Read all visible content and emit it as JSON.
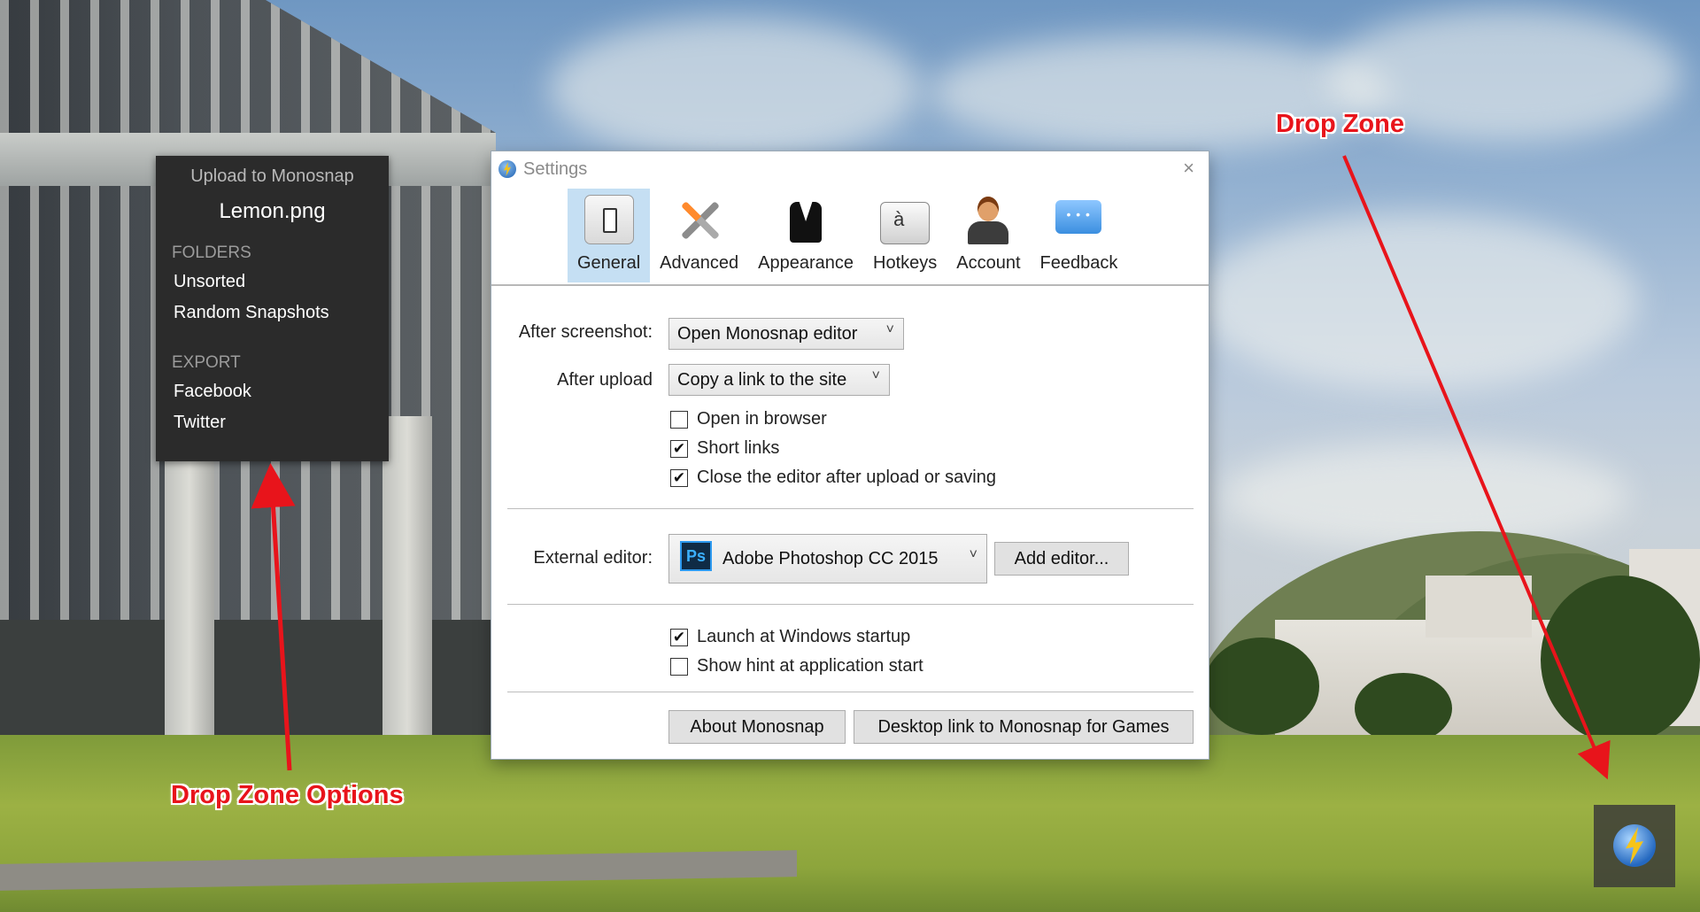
{
  "upload_menu": {
    "title": "Upload to Monosnap",
    "filename": "Lemon.png",
    "folders_heading": "FOLDERS",
    "folders": [
      "Unsorted",
      "Random Snapshots"
    ],
    "export_heading": "EXPORT",
    "exports": [
      "Facebook",
      "Twitter"
    ]
  },
  "settings": {
    "title": "Settings",
    "close_glyph": "×",
    "tabs": [
      {
        "label": "General",
        "icon": "general-switch-icon",
        "active": true
      },
      {
        "label": "Advanced",
        "icon": "tools-icon",
        "active": false
      },
      {
        "label": "Appearance",
        "icon": "tuxedo-icon",
        "active": false
      },
      {
        "label": "Hotkeys",
        "icon": "keyboard-key-icon",
        "active": false
      },
      {
        "label": "Account",
        "icon": "user-icon",
        "active": false
      },
      {
        "label": "Feedback",
        "icon": "chat-bubble-icon",
        "active": false
      }
    ],
    "after_screenshot_label": "After screenshot:",
    "after_screenshot_value": "Open Monosnap editor",
    "after_upload_label": "After upload",
    "after_upload_value": "Copy a link to the site",
    "options": [
      {
        "label": "Open in browser",
        "checked": false
      },
      {
        "label": "Short links",
        "checked": true
      },
      {
        "label": "Close the editor after upload or saving",
        "checked": true
      }
    ],
    "external_editor_label": "External editor:",
    "external_editor_value": "Adobe Photoshop CC 2015",
    "ps_icon_text": "Ps",
    "add_editor_label": "Add editor...",
    "startup_options": [
      {
        "label": "Launch at Windows startup",
        "checked": true
      },
      {
        "label": "Show hint at application start",
        "checked": false
      }
    ],
    "about_label": "About Monosnap",
    "desktop_link_label": "Desktop link to Monosnap for Games",
    "caret": "˅",
    "check_glyph": "✔"
  },
  "annotations": {
    "drop_zone": "Drop Zone",
    "drop_zone_options": "Drop Zone Options",
    "color": "#e8141b"
  }
}
